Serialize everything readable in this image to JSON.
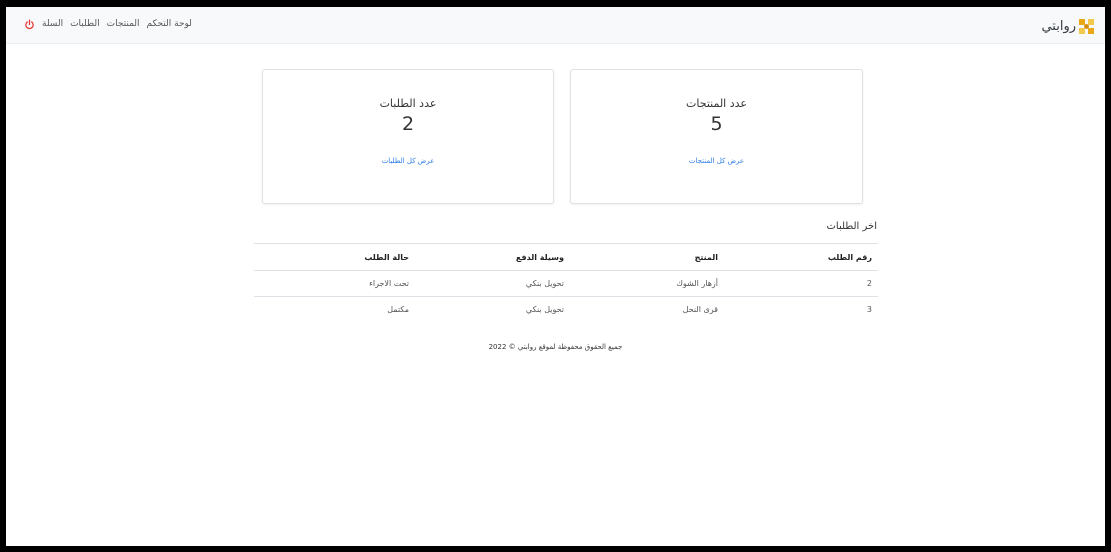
{
  "navbar": {
    "brand": "روابتي",
    "links": [
      "لوحة التحكم",
      "المنتجات",
      "الطلبات",
      "السلة"
    ],
    "logout_icon": "power-icon",
    "logout_color": "#e53935"
  },
  "cards": {
    "products": {
      "title": "عدد المنتجات",
      "count": "5",
      "link": "عرض كل المنتجات"
    },
    "orders": {
      "title": "عدد الطلبات",
      "count": "2",
      "link": "عرض كل الطلبات"
    }
  },
  "latest_orders": {
    "title": "اخر الطلبات",
    "headers": [
      "رقم الطلب",
      "المنتج",
      "وسيلة الدفع",
      "حالة الطلب"
    ],
    "rows": [
      [
        "2",
        "أزهار الشوك",
        "تحويل بنكي",
        "تحت الاجراء"
      ],
      [
        "3",
        "قرى النحل",
        "تحويل بنكي",
        "مكتمل"
      ]
    ]
  },
  "footer": {
    "text": "جميع الحقوق محفوظة لموقع روابتي © 2022"
  },
  "colors": {
    "link": "#2a7ce8",
    "navbar_bg": "#f8f9fa",
    "logo": "#e8a817"
  }
}
